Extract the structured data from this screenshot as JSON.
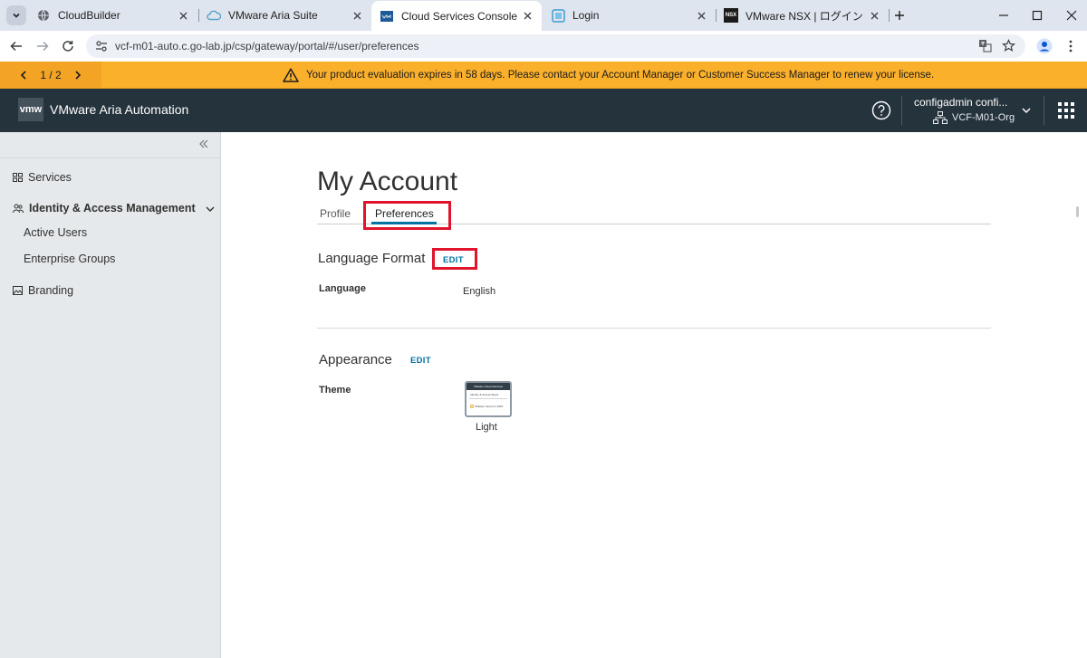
{
  "browser": {
    "tabs": [
      {
        "title": "CloudBuilder",
        "icon": "globe-icon",
        "active": false
      },
      {
        "title": "VMware Aria Suite",
        "icon": "cloud-icon",
        "active": false
      },
      {
        "title": "Cloud Services Console",
        "icon": "vmw-favicon-icon",
        "active": true
      },
      {
        "title": "Login",
        "icon": "login-favicon-icon",
        "active": false
      },
      {
        "title": "VMware NSX | ログイン",
        "icon": "nsx-favicon-icon",
        "active": false
      }
    ],
    "nsx_favicon_text": "NSX",
    "url": "vcf-m01-auto.c.go-lab.jp/csp/gateway/portal/#/user/preferences"
  },
  "banner": {
    "pager": "1 / 2",
    "message": "Your product evaluation expires in 58 days. Please contact your Account Manager or Customer Success Manager to renew your license.",
    "bg_color": "#fbb02b"
  },
  "header": {
    "logo": "vmw",
    "app_name": "VMware Aria Automation",
    "user_name": "configadmin confi...",
    "org_name": "VCF-M01-Org",
    "bg_color": "#25333d"
  },
  "sidebar": {
    "items": [
      {
        "label": "Services",
        "icon": "services-grid-icon"
      },
      {
        "label": "Identity & Access Management",
        "icon": "users-icon"
      },
      {
        "label": "Active Users"
      },
      {
        "label": "Enterprise Groups"
      },
      {
        "label": "Branding",
        "icon": "image-icon"
      }
    ]
  },
  "main": {
    "title": "My Account",
    "tabs": [
      "Profile",
      "Preferences"
    ],
    "active_tab": "Preferences",
    "sections": [
      {
        "title": "Language Format",
        "edit_label": "EDIT",
        "fields": [
          {
            "label": "Language",
            "value": "English"
          }
        ]
      },
      {
        "title": "Appearance",
        "edit_label": "EDIT",
        "fields": [
          {
            "label": "Theme",
            "value": "Light"
          }
        ]
      }
    ],
    "theme_thumbnail": {
      "header_text": "VMware Cloud Services",
      "text_1": "Identity & Access Mgmt",
      "text_2": "VMware Cloud on AWS"
    },
    "accent_color": "#0072a3",
    "highlight_color": "#e0152b"
  }
}
